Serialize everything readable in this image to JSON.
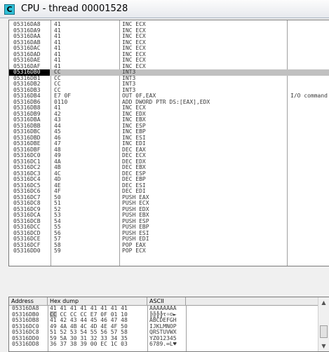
{
  "window": {
    "icon_letter": "C",
    "title": "CPU - thread 00001528"
  },
  "disasm": {
    "comment_text": "I/O command",
    "rows": [
      {
        "addr": "05316DA8",
        "hex": "41",
        "dis": "INC ECX",
        "com": ""
      },
      {
        "addr": "05316DA9",
        "hex": "41",
        "dis": "INC ECX",
        "com": ""
      },
      {
        "addr": "05316DAA",
        "hex": "41",
        "dis": "INC ECX",
        "com": ""
      },
      {
        "addr": "05316DAB",
        "hex": "41",
        "dis": "INC ECX",
        "com": ""
      },
      {
        "addr": "05316DAC",
        "hex": "41",
        "dis": "INC ECX",
        "com": ""
      },
      {
        "addr": "05316DAD",
        "hex": "41",
        "dis": "INC ECX",
        "com": ""
      },
      {
        "addr": "05316DAE",
        "hex": "41",
        "dis": "INC ECX",
        "com": ""
      },
      {
        "addr": "05316DAF",
        "hex": "41",
        "dis": "INC ECX",
        "com": ""
      },
      {
        "addr": "05316DB0",
        "hex": "CC",
        "dis": "INT3",
        "com": ""
      },
      {
        "addr": "05316DB1",
        "hex": "CC",
        "dis": "INT3",
        "com": ""
      },
      {
        "addr": "05316DB2",
        "hex": "CC",
        "dis": "INT3",
        "com": ""
      },
      {
        "addr": "05316DB3",
        "hex": "CC",
        "dis": "INT3",
        "com": ""
      },
      {
        "addr": "05316DB4",
        "hex": "E7 0F",
        "dis": "OUT 0F,EAX",
        "com": "I/O command"
      },
      {
        "addr": "05316DB6",
        "hex": "0110",
        "dis": "ADD DWORD PTR DS:[EAX],EDX",
        "com": ""
      },
      {
        "addr": "05316DB8",
        "hex": "41",
        "dis": "INC ECX",
        "com": ""
      },
      {
        "addr": "05316DB9",
        "hex": "42",
        "dis": "INC EDX",
        "com": ""
      },
      {
        "addr": "05316DBA",
        "hex": "43",
        "dis": "INC EBX",
        "com": ""
      },
      {
        "addr": "05316DBB",
        "hex": "44",
        "dis": "INC ESP",
        "com": ""
      },
      {
        "addr": "05316DBC",
        "hex": "45",
        "dis": "INC EBP",
        "com": ""
      },
      {
        "addr": "05316DBD",
        "hex": "46",
        "dis": "INC ESI",
        "com": ""
      },
      {
        "addr": "05316DBE",
        "hex": "47",
        "dis": "INC EDI",
        "com": ""
      },
      {
        "addr": "05316DBF",
        "hex": "48",
        "dis": "DEC EAX",
        "com": ""
      },
      {
        "addr": "05316DC0",
        "hex": "49",
        "dis": "DEC ECX",
        "com": ""
      },
      {
        "addr": "05316DC1",
        "hex": "4A",
        "dis": "DEC EDX",
        "com": ""
      },
      {
        "addr": "05316DC2",
        "hex": "4B",
        "dis": "DEC EBX",
        "com": ""
      },
      {
        "addr": "05316DC3",
        "hex": "4C",
        "dis": "DEC ESP",
        "com": ""
      },
      {
        "addr": "05316DC4",
        "hex": "4D",
        "dis": "DEC EBP",
        "com": ""
      },
      {
        "addr": "05316DC5",
        "hex": "4E",
        "dis": "DEC ESI",
        "com": ""
      },
      {
        "addr": "05316DC6",
        "hex": "4F",
        "dis": "DEC EDI",
        "com": ""
      },
      {
        "addr": "05316DC7",
        "hex": "50",
        "dis": "PUSH EAX",
        "com": ""
      },
      {
        "addr": "05316DC8",
        "hex": "51",
        "dis": "PUSH ECX",
        "com": ""
      },
      {
        "addr": "05316DC9",
        "hex": "52",
        "dis": "PUSH EDX",
        "com": ""
      },
      {
        "addr": "05316DCA",
        "hex": "53",
        "dis": "PUSH EBX",
        "com": ""
      },
      {
        "addr": "05316DCB",
        "hex": "54",
        "dis": "PUSH ESP",
        "com": ""
      },
      {
        "addr": "05316DCC",
        "hex": "55",
        "dis": "PUSH EBP",
        "com": ""
      },
      {
        "addr": "05316DCD",
        "hex": "56",
        "dis": "PUSH ESI",
        "com": ""
      },
      {
        "addr": "05316DCE",
        "hex": "57",
        "dis": "PUSH EDI",
        "com": ""
      },
      {
        "addr": "05316DCF",
        "hex": "58",
        "dis": "POP EAX",
        "com": ""
      },
      {
        "addr": "05316DD0",
        "hex": "59",
        "dis": "POP ECX",
        "com": ""
      }
    ],
    "selected_addr": "05316DB0"
  },
  "dump": {
    "headers": {
      "address": "Address",
      "hex": "Hex dump",
      "ascii": "ASCII"
    },
    "rows": [
      {
        "addr": "05316DA8",
        "hex": "41 41 41 41 41 41 41 41",
        "ascii": "AAAAAAAA"
      },
      {
        "addr": "05316DB0",
        "hex": "CC CC CC CC E7 0F 01 10",
        "ascii": "╠╠╠╠τ☼☺►"
      },
      {
        "addr": "05316DB8",
        "hex": "41 42 43 44 45 46 47 48",
        "ascii": "ABCDEFGH"
      },
      {
        "addr": "05316DC0",
        "hex": "49 4A 4B 4C 4D 4E 4F 50",
        "ascii": "IJKLMNOP"
      },
      {
        "addr": "05316DC8",
        "hex": "51 52 53 54 55 56 57 58",
        "ascii": "QRSTUVWX"
      },
      {
        "addr": "05316DD0",
        "hex": "59 5A 30 31 32 33 34 35",
        "ascii": "YZ012345"
      },
      {
        "addr": "05316DD8",
        "hex": "36 37 38 39 00 EC 1C 03",
        "ascii": "6789.∞L♥"
      }
    ]
  },
  "icons": {
    "scroll_up": "scroll-up-arrow-icon",
    "scroll_down": "scroll-down-arrow-icon"
  }
}
